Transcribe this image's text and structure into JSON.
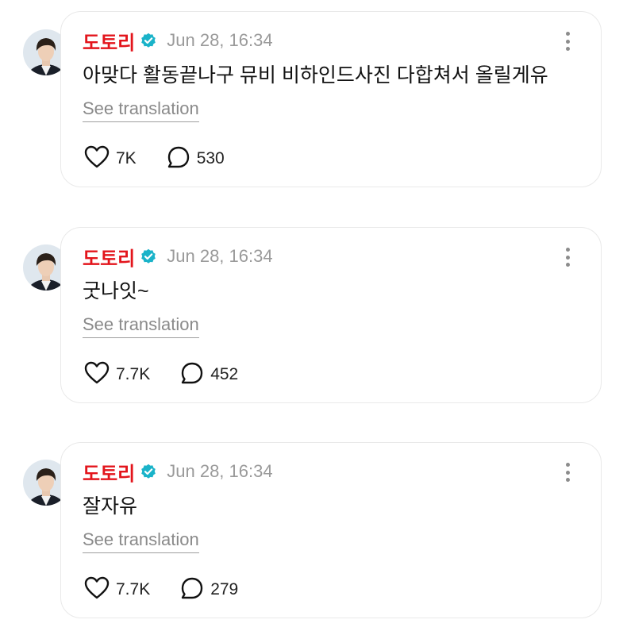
{
  "posts": [
    {
      "author": "도토리",
      "timestamp": "Jun 28, 16:34",
      "text": "아맞다 활동끝나구 뮤비 비하인드사진 다합쳐서 올릴게유",
      "translate_label": "See translation",
      "likes": "7K",
      "replies": "530"
    },
    {
      "author": "도토리",
      "timestamp": "Jun 28, 16:34",
      "text": "굿나잇~",
      "translate_label": "See translation",
      "likes": "7.7K",
      "replies": "452"
    },
    {
      "author": "도토리",
      "timestamp": "Jun 28, 16:34",
      "text": "잘자유",
      "translate_label": "See translation",
      "likes": "7.7K",
      "replies": "279"
    }
  ],
  "icons": {
    "verified": "verified-badge-icon",
    "more": "more-vertical-icon",
    "like": "heart-icon",
    "reply": "speech-bubble-icon"
  },
  "colors": {
    "author_name": "#e3151c",
    "verified_badge": "#1ab3c9",
    "timestamp": "#9a9a9a",
    "card_border": "#e9e9e9"
  }
}
